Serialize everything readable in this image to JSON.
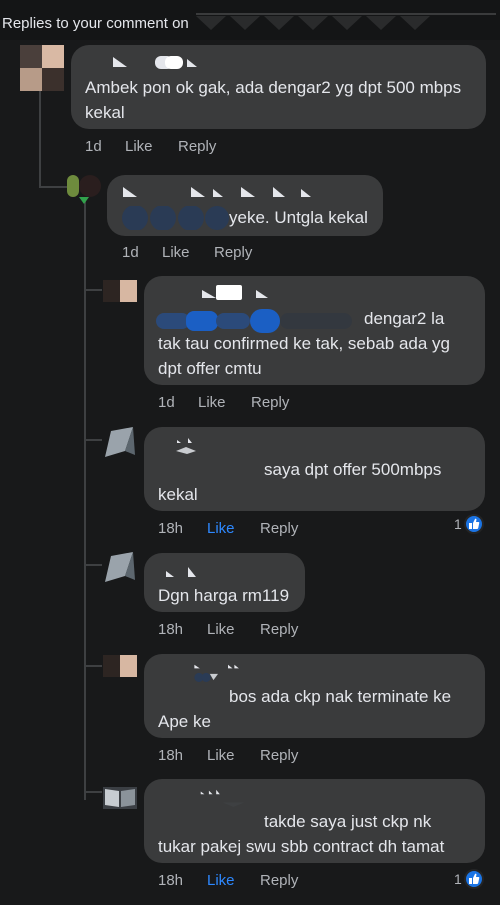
{
  "header": {
    "title": "Replies to your comment on"
  },
  "colors": {
    "background": "#18191a",
    "bubble": "#3a3b3c",
    "meta": "#b0b3b8",
    "like_active": "#2d88ff",
    "reaction": "#1b74e4"
  },
  "comments": [
    {
      "text": "Ambek pon ok gak, ada dengar2 yg dpt 500 mbps kekal",
      "time": "1d",
      "like": "Like",
      "reply": "Reply",
      "liked": false
    },
    {
      "text": "yeke. Untgla kekal",
      "time": "1d",
      "like": "Like",
      "reply": "Reply",
      "liked": false
    },
    {
      "text": "dengar2 la tak tau confirmed ke tak, sebab ada yg dpt offer cmtu",
      "text_a": "dengar2 la",
      "text_b": "tak tau confirmed ke tak, sebab ada yg",
      "text_c": "dpt offer cmtu",
      "time": "1d",
      "like": "Like",
      "reply": "Reply",
      "liked": false
    },
    {
      "text_a": "saya dpt offer 500mbps",
      "text_b": "kekal",
      "time": "18h",
      "like": "Like",
      "reply": "Reply",
      "liked": true,
      "reaction_count": "1",
      "reaction_icon": "thumbs-up-icon"
    },
    {
      "text": "Dgn harga rm119",
      "time": "18h",
      "like": "Like",
      "reply": "Reply",
      "liked": false
    },
    {
      "text_a": "bos ada ckp nak terminate ke",
      "text_b": "Ape ke",
      "time": "18h",
      "like": "Like",
      "reply": "Reply",
      "liked": false
    },
    {
      "text_a": "takde saya just ckp nk",
      "text_b": "tukar pakej swu sbb contract dh tamat",
      "time": "18h",
      "like": "Like",
      "reply": "Reply",
      "liked": true,
      "reaction_count": "1",
      "reaction_icon": "thumbs-up-icon"
    }
  ]
}
